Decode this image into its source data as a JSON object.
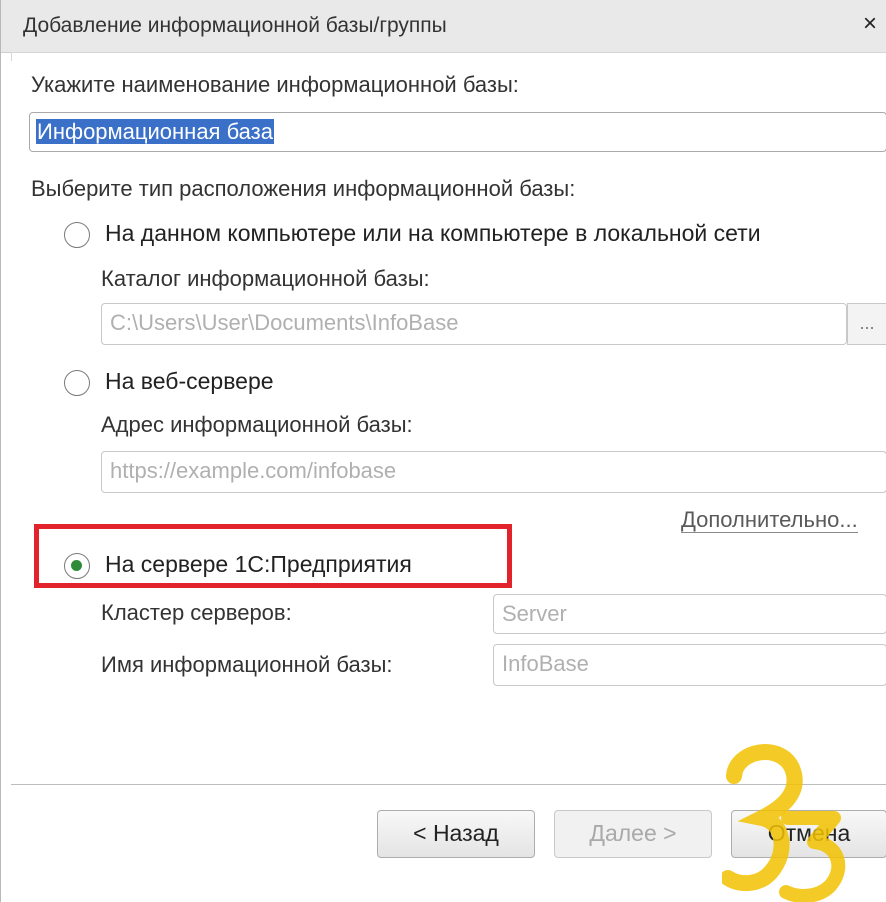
{
  "window": {
    "title": "Добавление информационной базы/группы",
    "close_glyph": "×"
  },
  "name_section": {
    "label": "Укажите наименование информационной базы:",
    "value": "Информационная база"
  },
  "location": {
    "label": "Выберите тип расположения информационной базы:",
    "options": [
      {
        "label": "На данном компьютере или на компьютере в локальной сети",
        "selected": false,
        "field_label": "Каталог информационной базы:",
        "field_value": "C:\\Users\\User\\Documents\\InfoBase",
        "browse_label": "..."
      },
      {
        "label": "На веб-сервере",
        "selected": false,
        "field_label": "Адрес информационной базы:",
        "field_placeholder": "https://example.com/infobase"
      },
      {
        "label": "На сервере 1С:Предприятия",
        "selected": true,
        "cluster_label": "Кластер серверов:",
        "cluster_value": "Server",
        "db_label": "Имя информационной базы:",
        "db_value": "InfoBase"
      }
    ],
    "more_link": "Дополнительно..."
  },
  "buttons": {
    "back": "< Назад",
    "next": "Далее >",
    "cancel": "Отмена"
  },
  "colors": {
    "highlight": "#e2232b",
    "radio_dot": "#2e8b3a",
    "selection": "#3a70c8",
    "watermark": "#f2c200"
  }
}
